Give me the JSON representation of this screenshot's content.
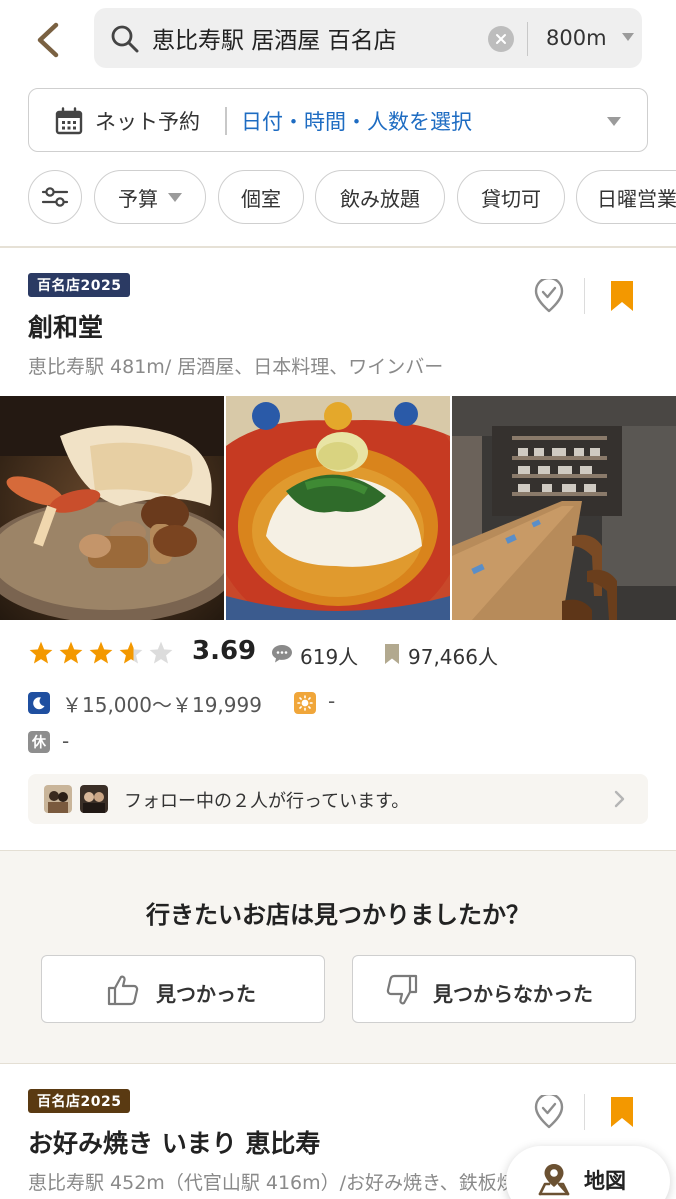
{
  "search": {
    "query": "恵比寿駅 居酒屋 百名店",
    "radius": "800m"
  },
  "reservation": {
    "label": "ネット予約",
    "value": "日付・時間・人数を選択"
  },
  "filters": {
    "chips": [
      "予算",
      "個室",
      "飲み放題",
      "貸切可",
      "日曜営業"
    ]
  },
  "restaurants": [
    {
      "badge": "百名店2025",
      "name": "創和堂",
      "meta": "恵比寿駅 481m/ 居酒屋、日本料理、ワインバー",
      "rating": "3.69",
      "rating_value": 3.69,
      "reviews": "619人",
      "saves": "97,466人",
      "dinner_price": "￥15,000～￥19,999",
      "lunch_price": "-",
      "closed_icon": "休",
      "holiday": "-",
      "follow_text": "フォロー中の２人が行っています。"
    },
    {
      "badge": "百名店2025",
      "name": "お好み焼き いまり 恵比寿",
      "meta": "恵比寿駅 452m（代官山駅 416m）/お好み焼き、鉄板焼き"
    }
  ],
  "feedback": {
    "title": "行きたいお店は見つかりましたか？",
    "yes": "見つかった",
    "no": "見つからなかった"
  },
  "map_button": {
    "label": "地図"
  },
  "colors": {
    "accent_orange": "#f39800",
    "link_blue": "#1e6cc2",
    "badge_navy": "#2b3a63",
    "badge_brown": "#5a3a12",
    "beige": "#f7f5f1",
    "dinner_icon": "#1f4fa0",
    "lunch_icon": "#f0a63a"
  },
  "icons": [
    "back-arrow-icon",
    "search-icon",
    "clear-icon",
    "calendar-icon",
    "filter-sliders-icon",
    "heart-check-icon",
    "bookmark-icon",
    "star-icon",
    "comment-icon",
    "moon-icon",
    "sun-icon",
    "chevron-right-icon",
    "thumbs-up-icon",
    "thumbs-down-icon",
    "map-pin-icon"
  ]
}
